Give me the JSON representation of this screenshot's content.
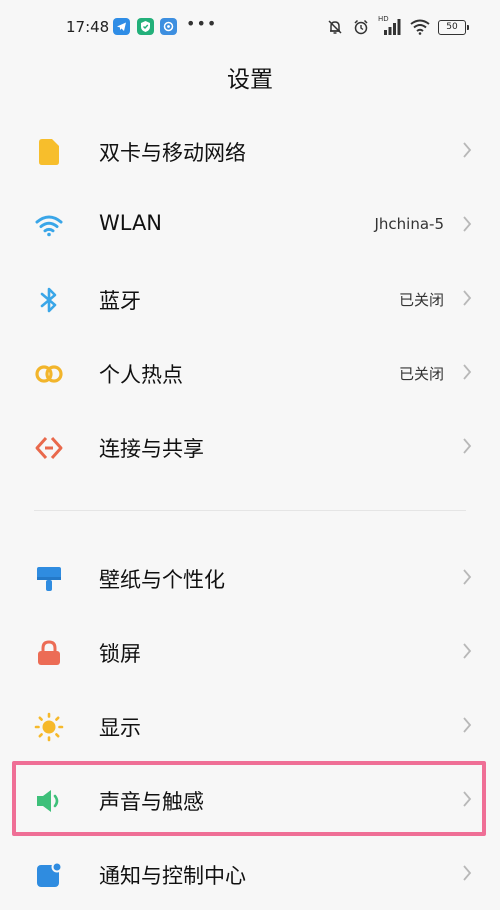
{
  "status": {
    "time": "17:48",
    "hd": "HD",
    "battery": "50",
    "dots": "•••"
  },
  "title": "设置",
  "items": [
    {
      "label": "双卡与移动网络",
      "value": "",
      "icon": "sim-card-icon"
    },
    {
      "label": "WLAN",
      "value": "Jhchina-5",
      "icon": "wifi-icon"
    },
    {
      "label": "蓝牙",
      "value": "已关闭",
      "icon": "bluetooth-icon"
    },
    {
      "label": "个人热点",
      "value": "已关闭",
      "icon": "hotspot-icon"
    },
    {
      "label": "连接与共享",
      "value": "",
      "icon": "connection-share-icon"
    },
    {
      "label": "壁纸与个性化",
      "value": "",
      "icon": "wallpaper-icon"
    },
    {
      "label": "锁屏",
      "value": "",
      "icon": "lock-icon"
    },
    {
      "label": "显示",
      "value": "",
      "icon": "brightness-icon"
    },
    {
      "label": "声音与触感",
      "value": "",
      "icon": "speaker-icon"
    },
    {
      "label": "通知与控制中心",
      "value": "",
      "icon": "notification-icon"
    }
  ],
  "colors": {
    "highlight": "#ef6f96",
    "sim": "#f7be2c",
    "wifi": "#3aa6e8",
    "bluetooth": "#3aa6e8",
    "hotspot": "#f2b52b",
    "share": "#e9694c",
    "wallpaper": "#2f8ce0",
    "lock": "#ec6c55",
    "display": "#f6b92b",
    "sound": "#3ec07a",
    "notification": "#2f8ce0"
  }
}
